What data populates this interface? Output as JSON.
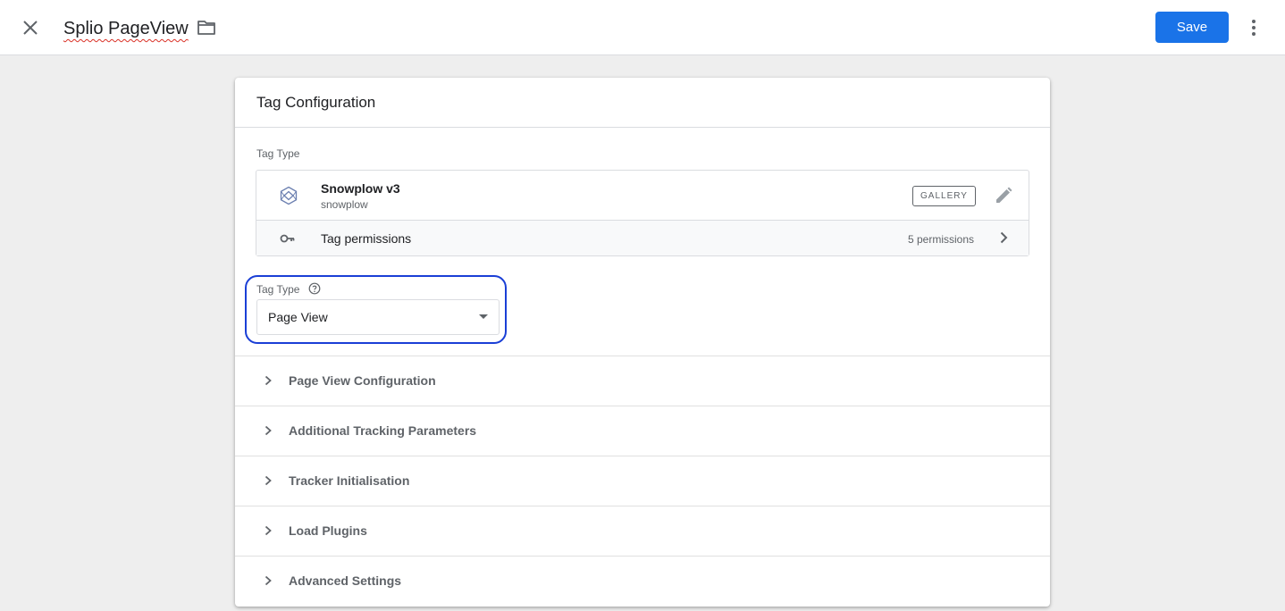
{
  "header": {
    "title": "Splio PageView",
    "save_label": "Save"
  },
  "card": {
    "title": "Tag Configuration",
    "tag_type_section_label": "Tag Type",
    "template": {
      "name": "Snowplow v3",
      "id": "snowplow",
      "badge": "GALLERY"
    },
    "permissions": {
      "label": "Tag permissions",
      "count": "5 permissions"
    },
    "field": {
      "label": "Tag Type",
      "value": "Page View"
    },
    "sections": [
      {
        "label": "Page View Configuration"
      },
      {
        "label": "Additional Tracking Parameters"
      },
      {
        "label": "Tracker Initialisation"
      },
      {
        "label": "Load Plugins"
      },
      {
        "label": "Advanced Settings"
      }
    ]
  },
  "colors": {
    "accent": "#1a73e8",
    "highlight": "#1a3fd6",
    "background": "#eeeeee"
  },
  "icons": [
    "close-icon",
    "folder-icon",
    "more-vert-icon",
    "snowplow-logo-icon",
    "pencil-icon",
    "key-icon",
    "chevron-right-icon",
    "help-icon",
    "dropdown-arrow-icon"
  ]
}
